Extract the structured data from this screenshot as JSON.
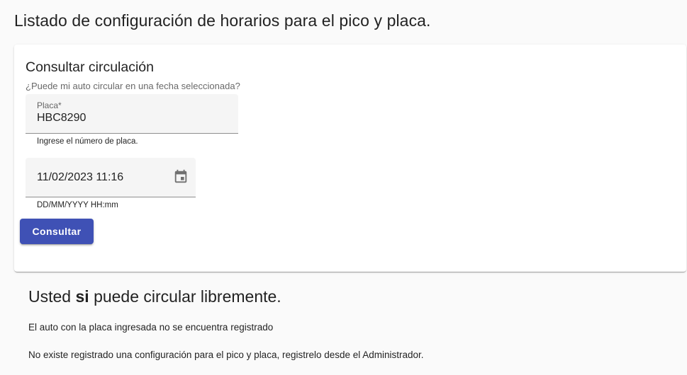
{
  "page": {
    "title": "Listado de configuración de horarios para el pico y placa."
  },
  "form": {
    "title": "Consultar circulación",
    "subtitle": "¿Puede mi auto circular en una fecha seleccionada?",
    "plate": {
      "label": "Placa*",
      "value": "HBC8290",
      "hint": "Ingrese el número de placa."
    },
    "datetime": {
      "value": "11/02/2023 11:16",
      "hint": "DD/MM/YYYY HH:mm",
      "icon": "calendar-icon"
    },
    "submit_label": "Consultar"
  },
  "result": {
    "heading_prefix": "Usted",
    "heading_bold": "si",
    "heading_suffix": "puede circular libremente.",
    "line1": "El auto con la placa ingresada no se encuentra registrado",
    "line2": "No existe registrado una configuración para el pico y placa, registrelo desde el Administrador."
  },
  "colors": {
    "primary": "#3f51b5",
    "background": "#fafafa",
    "card": "#ffffff",
    "field_bg": "#f5f5f5"
  }
}
